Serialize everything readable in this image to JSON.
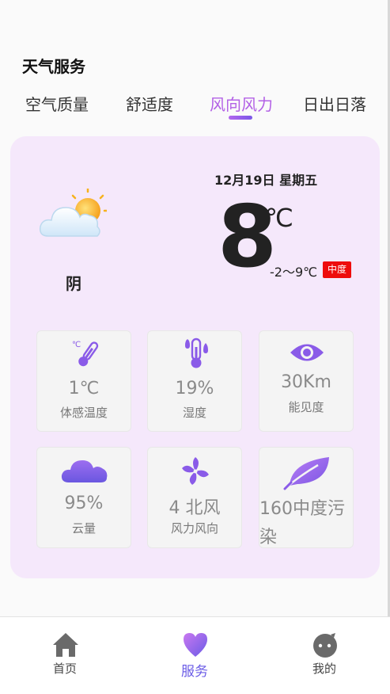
{
  "header": {
    "title": "天气服务"
  },
  "tabs": [
    {
      "label": "空气质量",
      "active": false
    },
    {
      "label": "舒适度",
      "active": false
    },
    {
      "label": "风向风力",
      "active": true
    },
    {
      "label": "日出日落",
      "active": false
    }
  ],
  "weather": {
    "condition": "阴",
    "date": "12月19日 星期五",
    "temperature": "8",
    "unit": "℃",
    "range": "-2〜9℃",
    "air_quality_badge": "中度",
    "icon": "cloud-sun-icon"
  },
  "details": [
    {
      "value": "1℃",
      "label": "体感温度",
      "icon": "thermometer-icon"
    },
    {
      "value": "19%",
      "label": "湿度",
      "icon": "humidity-icon"
    },
    {
      "value": "30Km",
      "label": "能见度",
      "icon": "eye-icon"
    },
    {
      "value": "95%",
      "label": "云量",
      "icon": "cloud-icon"
    },
    {
      "value": "4 北风",
      "label": "风力风向",
      "icon": "fan-icon"
    },
    {
      "value": "160中度污染",
      "label": "",
      "icon": "leaf-icon"
    }
  ],
  "bottom_nav": [
    {
      "label": "首页",
      "icon": "home-icon",
      "active": false
    },
    {
      "label": "服务",
      "icon": "heart-icon",
      "active": true
    },
    {
      "label": "我的",
      "icon": "profile-face-icon",
      "active": false
    }
  ],
  "colors": {
    "accent": "#b361e6",
    "nav_active": "#6a5be6",
    "card_bg": "#f5e8fb",
    "badge_red": "#ee0c0c"
  }
}
